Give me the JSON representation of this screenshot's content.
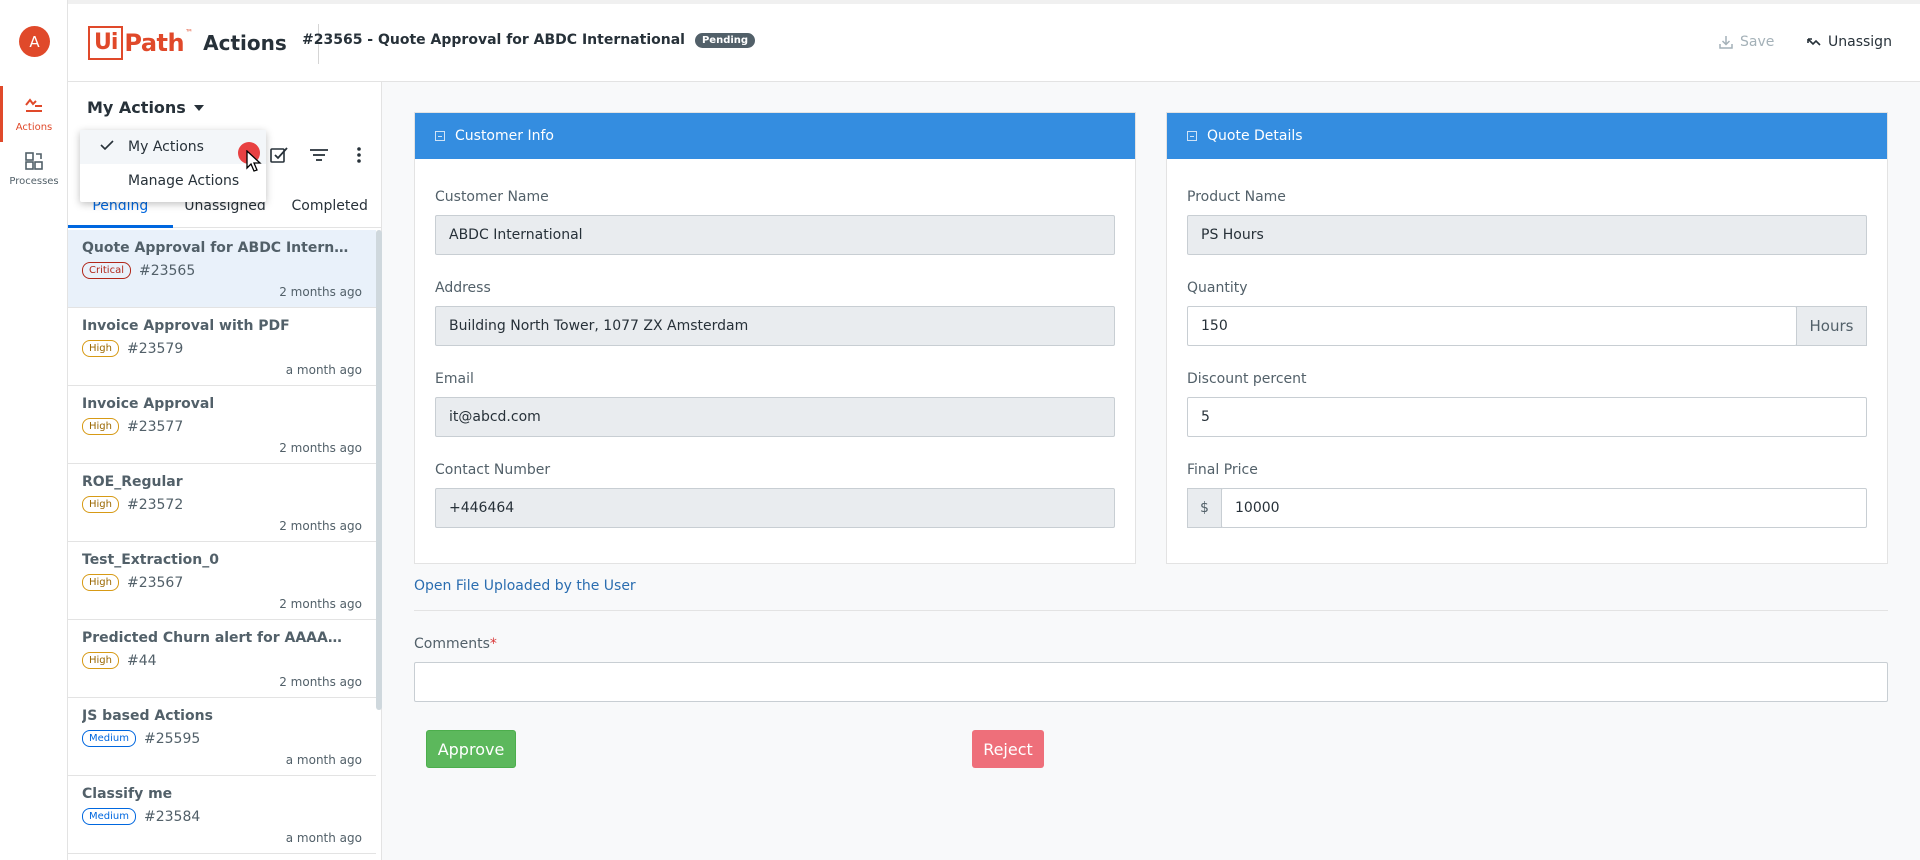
{
  "user": {
    "avatar_initial": "A"
  },
  "rail": {
    "items": [
      {
        "label": "Actions",
        "icon": "actions-icon",
        "active": true
      },
      {
        "label": "Processes",
        "icon": "processes-icon",
        "active": false
      }
    ]
  },
  "header": {
    "logo_ui": "Ui",
    "logo_path": "Path",
    "logo_tm": "™",
    "logo_product": "Actions",
    "task_title": "#23565 - Quote Approval for ABDC International",
    "status_badge": "Pending",
    "save_label": "Save",
    "unassign_label": "Unassign"
  },
  "panel": {
    "title": "My Actions",
    "dropdown": [
      {
        "label": "My Actions",
        "checked": true
      },
      {
        "label": "Manage Actions",
        "checked": false
      }
    ],
    "tabs": [
      {
        "label": "Pending",
        "active": true
      },
      {
        "label": "Unassigned",
        "active": false
      },
      {
        "label": "Completed",
        "active": false
      }
    ],
    "items": [
      {
        "title": "Quote Approval for ABDC Internati...",
        "priority": "Critical",
        "id": "#23565",
        "time": "2 months ago",
        "selected": true
      },
      {
        "title": "Invoice Approval with PDF",
        "priority": "High",
        "id": "#23579",
        "time": "a month ago",
        "selected": false
      },
      {
        "title": "Invoice Approval",
        "priority": "High",
        "id": "#23577",
        "time": "2 months ago",
        "selected": false
      },
      {
        "title": "ROE_Regular",
        "priority": "High",
        "id": "#23572",
        "time": "2 months ago",
        "selected": false
      },
      {
        "title": "Test_Extraction_0",
        "priority": "High",
        "id": "#23567",
        "time": "2 months ago",
        "selected": false
      },
      {
        "title": "Predicted Churn alert for AAAAA | ...",
        "priority": "High",
        "id": "#44",
        "time": "2 months ago",
        "selected": false
      },
      {
        "title": "JS based Actions",
        "priority": "Medium",
        "id": "#25595",
        "time": "a month ago",
        "selected": false
      },
      {
        "title": "Classify me",
        "priority": "Medium",
        "id": "#23584",
        "time": "a month ago",
        "selected": false
      }
    ]
  },
  "customer_info": {
    "title": "Customer Info",
    "customer_name_label": "Customer Name",
    "customer_name": "ABDC International",
    "address_label": "Address",
    "address": "Building North Tower, 1077 ZX Amsterdam",
    "email_label": "Email",
    "email": "it@abcd.com",
    "contact_label": "Contact Number",
    "contact": "+446464"
  },
  "quote_details": {
    "title": "Quote Details",
    "product_label": "Product Name",
    "product": "PS Hours",
    "quantity_label": "Quantity",
    "quantity": "150",
    "quantity_unit": "Hours",
    "discount_label": "Discount percent",
    "discount": "5",
    "final_price_label": "Final Price",
    "currency": "$",
    "final_price": "10000"
  },
  "form": {
    "file_link": "Open File Uploaded by the User",
    "comments_label": "Comments",
    "required_mark": "*",
    "comments_value": "",
    "approve_label": "Approve",
    "reject_label": "Reject"
  },
  "colors": {
    "brand": "#e0492a",
    "card_header": "#348de0",
    "approve": "#5cb85c",
    "reject": "#ee6f7a",
    "active_tab": "#0067df"
  }
}
